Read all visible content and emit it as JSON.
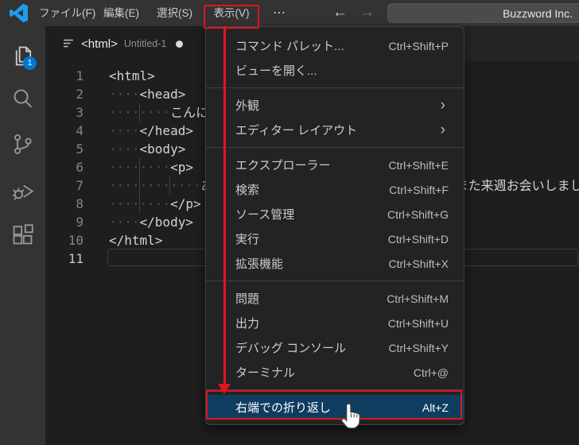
{
  "title_bar": {
    "menus": [
      {
        "label": "ファイル(F)"
      },
      {
        "label": "編集(E)"
      },
      {
        "label": "選択(S)"
      },
      {
        "label": "表示(V)",
        "active": true
      },
      {
        "label": "⋯"
      }
    ],
    "nav": {
      "back": "←",
      "forward": "→"
    },
    "command_center": "Buzzword Inc."
  },
  "activity_bar": {
    "badge": "1",
    "items": [
      "explorer",
      "search",
      "source-control",
      "run-and-debug",
      "extensions"
    ]
  },
  "tab": {
    "label": "<html>",
    "description": "Untitled-1"
  },
  "editor": {
    "lines": [
      {
        "num": "1",
        "text": "<html>"
      },
      {
        "num": "2",
        "text": "    <head>"
      },
      {
        "num": "3",
        "text": "        こんにちは"
      },
      {
        "num": "4",
        "text": "    </head>"
      },
      {
        "num": "5",
        "text": "    <body>"
      },
      {
        "num": "6",
        "text": "        <p>"
      },
      {
        "num": "7",
        "text": "            ありがとうございました。お疲れ様ですね。また来週お会いしましょう"
      },
      {
        "num": "8",
        "text": "        </p>"
      },
      {
        "num": "9",
        "text": "    </body>"
      },
      {
        "num": "10",
        "text": "</html>"
      },
      {
        "num": "11",
        "text": ""
      }
    ]
  },
  "view_menu": {
    "sections": [
      {
        "items": [
          {
            "name": "command-palette",
            "label": "コマンド パレット...",
            "shortcut": "Ctrl+Shift+P"
          },
          {
            "name": "open-view",
            "label": "ビューを開く...",
            "shortcut": ""
          }
        ]
      },
      {
        "items": [
          {
            "name": "appearance",
            "label": "外観",
            "submenu": true
          },
          {
            "name": "editor-layout",
            "label": "エディター レイアウト",
            "submenu": true
          }
        ]
      },
      {
        "items": [
          {
            "name": "explorer",
            "label": "エクスプローラー",
            "shortcut": "Ctrl+Shift+E"
          },
          {
            "name": "search",
            "label": "検索",
            "shortcut": "Ctrl+Shift+F"
          },
          {
            "name": "source-control",
            "label": "ソース管理",
            "shortcut": "Ctrl+Shift+G"
          },
          {
            "name": "run",
            "label": "実行",
            "shortcut": "Ctrl+Shift+D"
          },
          {
            "name": "extensions",
            "label": "拡張機能",
            "shortcut": "Ctrl+Shift+X"
          }
        ]
      },
      {
        "items": [
          {
            "name": "problems",
            "label": "問題",
            "shortcut": "Ctrl+Shift+M"
          },
          {
            "name": "output",
            "label": "出力",
            "shortcut": "Ctrl+Shift+U"
          },
          {
            "name": "debug-console",
            "label": "デバッグ コンソール",
            "shortcut": "Ctrl+Shift+Y"
          },
          {
            "name": "terminal",
            "label": "ターミナル",
            "shortcut": "Ctrl+@"
          }
        ]
      },
      {
        "items": [
          {
            "name": "word-wrap",
            "label": "右端での折り返し",
            "shortcut": "Alt+Z",
            "highlighted": true
          }
        ]
      }
    ]
  },
  "colors": {
    "annotation_red": "#e0151f",
    "menu_highlight_blue": "#0e3d60",
    "badge_blue": "#0078d4",
    "logo_blue": "#1f9cf0",
    "titlebar_bg": "#333333",
    "editor_bg": "#1e1e1e",
    "menu_bg": "#232325"
  }
}
